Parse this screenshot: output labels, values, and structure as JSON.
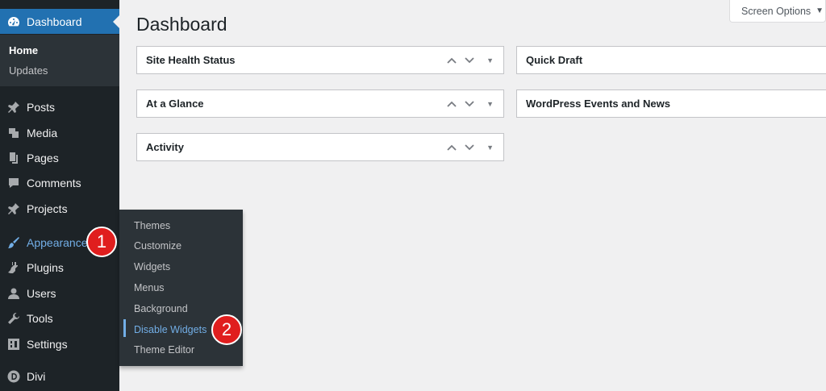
{
  "sidebar": {
    "dashboard": "Dashboard",
    "sub": [
      "Home",
      "Updates"
    ],
    "items": [
      "Posts",
      "Media",
      "Pages",
      "Comments",
      "Projects",
      "Appearance",
      "Plugins",
      "Users",
      "Tools",
      "Settings",
      "Divi"
    ]
  },
  "flyout": [
    "Themes",
    "Customize",
    "Widgets",
    "Menus",
    "Background",
    "Disable Widgets",
    "Theme Editor"
  ],
  "badges": [
    "1",
    "2"
  ],
  "main": {
    "title": "Dashboard",
    "screen_options": "Screen Options",
    "boxes_left": [
      "Site Health Status",
      "At a Glance",
      "Activity"
    ],
    "boxes_right": [
      "Quick Draft",
      "WordPress Events and News"
    ]
  },
  "colors": {
    "sidebar": "#1d2327",
    "active": "#2271b1",
    "accent": "#72aee6",
    "badge": "#e01e1e"
  }
}
